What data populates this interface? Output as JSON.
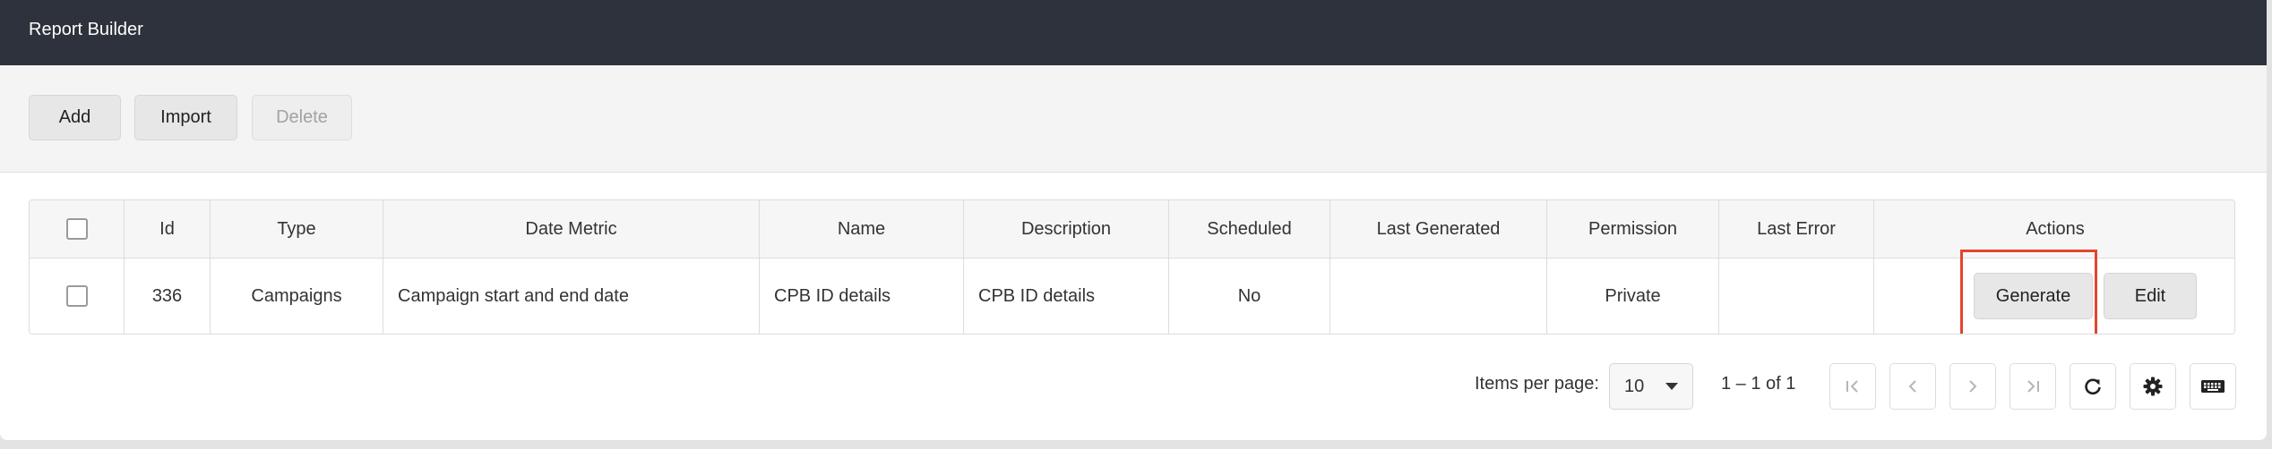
{
  "app": {
    "title": "Report Builder"
  },
  "toolbar": {
    "add_label": "Add",
    "import_label": "Import",
    "delete_label": "Delete"
  },
  "table": {
    "columns": [
      "Id",
      "Type",
      "Date Metric",
      "Name",
      "Description",
      "Scheduled",
      "Last Generated",
      "Permission",
      "Last Error",
      "Actions"
    ],
    "rows": [
      {
        "id": "336",
        "type": "Campaigns",
        "date_metric": "Campaign start and end date",
        "name": "CPB ID details",
        "description": "CPB ID details",
        "scheduled": "No",
        "last_generated": "",
        "permission": "Private",
        "last_error": "",
        "actions": {
          "generate_label": "Generate",
          "edit_label": "Edit"
        }
      }
    ]
  },
  "paginator": {
    "items_per_page_label": "Items per page:",
    "page_size": "10",
    "range_label": "1 – 1 of 1"
  },
  "colors": {
    "header_bg": "#2d323c",
    "highlight": "#e4442d",
    "toolbar_bg": "#f4f4f4"
  },
  "icons": [
    "first-page-icon",
    "previous-page-icon",
    "next-page-icon",
    "last-page-icon",
    "refresh-icon",
    "gear-icon",
    "keyboard-icon"
  ]
}
